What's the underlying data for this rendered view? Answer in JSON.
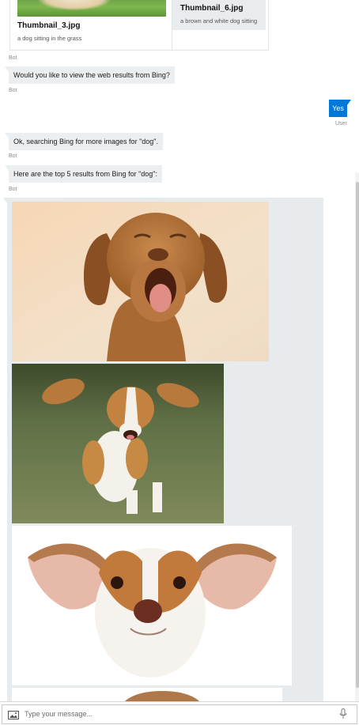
{
  "carousel": {
    "cards": [
      {
        "title": "Thumbnail_3.jpg",
        "subtitle": "a dog sitting in the grass"
      },
      {
        "title": "Thumbnail_6.jpg",
        "subtitle": "a brown and white dog sitting"
      }
    ],
    "sender": "Bot"
  },
  "messages": [
    {
      "text": "Would you like to view the web results from Bing?",
      "sender": "Bot"
    },
    {
      "text": "Yes",
      "sender": "User"
    },
    {
      "text": "Ok, searching Bing for more images for \"dog\".",
      "sender": "Bot"
    },
    {
      "text": "Here are the top 5 results from Bing for \"dog\":",
      "sender": "Bot"
    }
  ],
  "results": {
    "images": [
      {
        "icon": "dog-yawning-image"
      },
      {
        "icon": "dog-running-image"
      },
      {
        "icon": "dog-big-ears-image"
      },
      {
        "icon": "dog-partial-image"
      }
    ]
  },
  "input": {
    "placeholder": "Type your message...",
    "attach_icon": "image-icon",
    "mic_icon": "microphone-icon"
  },
  "colors": {
    "user_bubble": "#0078d7",
    "bot_bubble": "#eceff1",
    "results_panel": "#e8ebee"
  }
}
